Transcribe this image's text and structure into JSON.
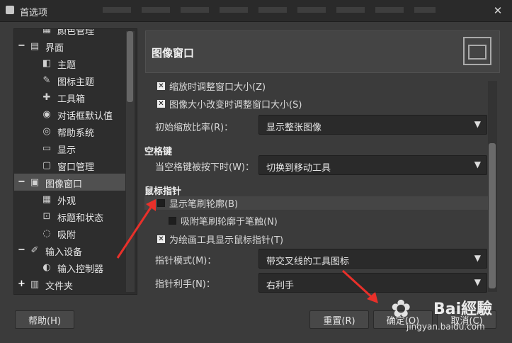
{
  "window": {
    "title": "首选项",
    "close_glyph": "✕"
  },
  "tree": {
    "items": [
      {
        "label": "颜色管理",
        "icon": "color-management-icon",
        "glyph": "▦",
        "level": 1,
        "expander": "",
        "partial": true
      },
      {
        "label": "界面",
        "icon": "interface-icon",
        "glyph": "▤",
        "level": 0,
        "expander": "−"
      },
      {
        "label": "主题",
        "icon": "theme-icon",
        "glyph": "◧",
        "level": 1,
        "expander": ""
      },
      {
        "label": "图标主题",
        "icon": "icon-theme-icon",
        "glyph": "✎",
        "level": 1,
        "expander": ""
      },
      {
        "label": "工具箱",
        "icon": "toolbox-icon",
        "glyph": "✚",
        "level": 1,
        "expander": ""
      },
      {
        "label": "对话框默认值",
        "icon": "dialog-defaults-icon",
        "glyph": "◉",
        "level": 1,
        "expander": ""
      },
      {
        "label": "帮助系统",
        "icon": "help-system-icon",
        "glyph": "◎",
        "level": 1,
        "expander": ""
      },
      {
        "label": "显示",
        "icon": "display-icon",
        "glyph": "▭",
        "level": 1,
        "expander": ""
      },
      {
        "label": "窗口管理",
        "icon": "window-management-icon",
        "glyph": "▢",
        "level": 1,
        "expander": ""
      },
      {
        "label": "图像窗口",
        "icon": "image-window-icon",
        "glyph": "▣",
        "level": 0,
        "expander": "−",
        "selected": true
      },
      {
        "label": "外观",
        "icon": "appearance-icon",
        "glyph": "▦",
        "level": 1,
        "expander": ""
      },
      {
        "label": "标题和状态",
        "icon": "title-status-icon",
        "glyph": "⊡",
        "level": 1,
        "expander": ""
      },
      {
        "label": "吸附",
        "icon": "snap-icon",
        "glyph": "◌",
        "level": 1,
        "expander": ""
      },
      {
        "label": "输入设备",
        "icon": "input-devices-icon",
        "glyph": "✐",
        "level": 0,
        "expander": "−"
      },
      {
        "label": "输入控制器",
        "icon": "input-controller-icon",
        "glyph": "◐",
        "level": 1,
        "expander": ""
      },
      {
        "label": "文件夹",
        "icon": "folders-icon",
        "glyph": "▥",
        "level": 0,
        "expander": "+"
      }
    ]
  },
  "header": {
    "title": "图像窗口",
    "icon": "image-window-large-icon"
  },
  "options": {
    "resize_on_zoom": {
      "label": "缩放时调整窗口大小(Z)",
      "checked": true
    },
    "resize_on_image_change": {
      "label": "图像大小改变时调整窗口大小(S)",
      "checked": true
    },
    "initial_zoom": {
      "label": "初始缩放比率(R)：",
      "value": "显示整张图像"
    },
    "space_section": "空格键",
    "space_action": {
      "label": "当空格键被按下时(W)：",
      "value": "切换到移动工具"
    },
    "pointer_section": "鼠标指针",
    "show_brush_outline": {
      "label": "显示笔刷轮廓(B)",
      "checked": false
    },
    "snap_brush_outline": {
      "label": "吸附笔刷轮廓于笔触(N)",
      "checked": false
    },
    "show_paint_pointer": {
      "label": "为绘画工具显示鼠标指针(T)",
      "checked": true
    },
    "pointer_mode": {
      "label": "指针模式(M)：",
      "value": "带交叉线的工具图标"
    },
    "pointer_handedness": {
      "label": "指针利手(N)：",
      "value": "右利手"
    }
  },
  "buttons": {
    "help": "帮助(H)",
    "reset": "重置(R)",
    "ok": "确定(O)",
    "cancel": "取消(C)"
  },
  "watermark": {
    "brand": "Bai經驗",
    "url": "jingyan.baidu.com"
  },
  "colors": {
    "annotation_arrow": "#e8302a",
    "selected_row": "#505050"
  }
}
